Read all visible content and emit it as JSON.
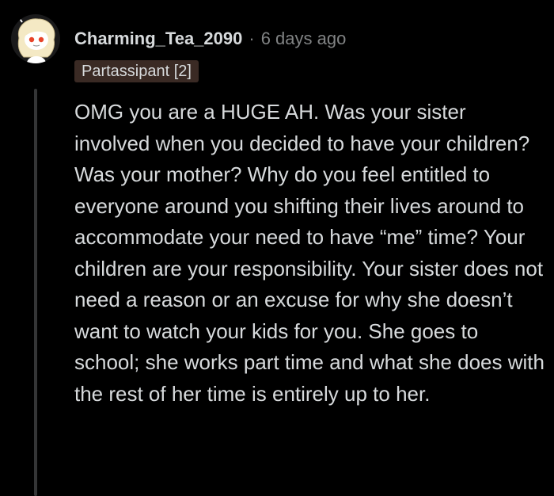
{
  "comment": {
    "username": "Charming_Tea_2090",
    "separator": "·",
    "timestamp": "6 days ago",
    "flair": "Partassipant [2]",
    "body": "OMG you are a HUGE AH. Was your sister involved when you decided to have your children? Was your mother? Why do you feel entitled to everyone around you shifting their lives around to accommodate your need to have “me” time? Your children are your responsibility. Your sister does not need a reason or an excuse for why she doesn’t want to watch your kids for you. She goes to school; she works part time and what she does with the rest of her time is entirely up to her."
  },
  "avatar": {
    "icon": "snoo-avatar-icon",
    "hair_color": "#f4e9c4",
    "skin_color": "#ffffff",
    "eye_color": "#e8442a"
  },
  "colors": {
    "background": "#000000",
    "text": "#d7dadc",
    "meta": "#818384",
    "flair_bg": "#3a2a24",
    "thread_line": "#343536"
  }
}
